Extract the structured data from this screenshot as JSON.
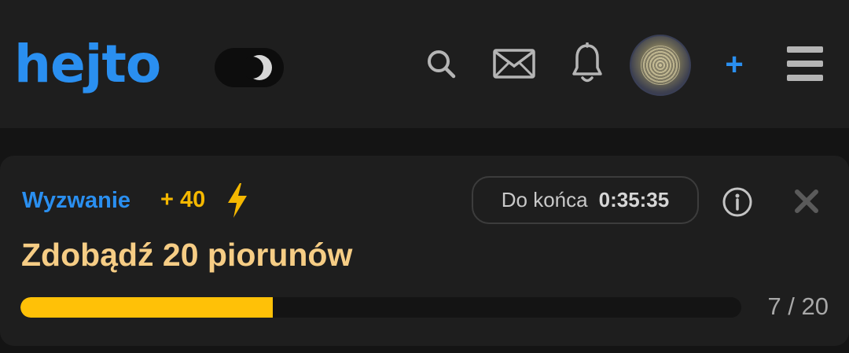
{
  "header": {
    "logo_text": "hejto",
    "brand_color": "#2a8ff0",
    "theme_toggle_state": "dark",
    "icons": [
      "search-icon",
      "mail-icon",
      "bell-icon",
      "avatar",
      "plus-icon",
      "hamburger-menu-icon"
    ],
    "plus_label": "+"
  },
  "challenge": {
    "label": "Wyzwanie",
    "points": "+ 40",
    "timer_label": "Do końca",
    "timer_value": "0:35:35",
    "title": "Zdobądź 20 piorunów",
    "progress_current": 7,
    "progress_total": 20,
    "progress_text": "7 / 20",
    "progress_color": "#ffc107",
    "accent_color": "#f5b800",
    "title_color": "#f6cd85"
  }
}
